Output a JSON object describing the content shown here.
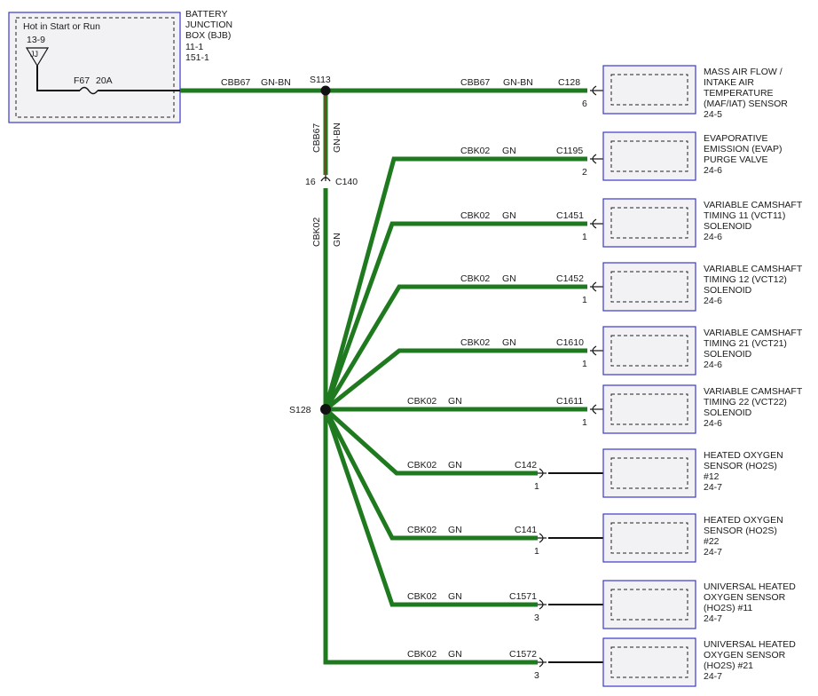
{
  "bjb": {
    "hot_label": "Hot in Start or Run",
    "pin_ref": "13-9",
    "icon_label": "JJ",
    "fuse_label": "F67",
    "fuse_rating": "20A",
    "title_lines": [
      "BATTERY",
      "JUNCTION",
      "BOX (BJB)",
      "11-1",
      "151-1"
    ]
  },
  "splices": {
    "s113": "S113",
    "s128": "S128"
  },
  "main_wire": {
    "left_circuit": "CBB67",
    "left_color": "GN-BN",
    "right_circuit": "CBB67",
    "right_color": "GN-BN",
    "vertical_circuit": "CBB67",
    "vertical_color": "GN-BN"
  },
  "c140": {
    "connector": "C140",
    "pin": "16",
    "lower_circuit": "CBK02",
    "lower_color": "GN"
  },
  "branches": [
    {
      "circuit": "CBB67",
      "color": "GN-BN",
      "connector": "C128",
      "pin": "6",
      "lines": [
        "MASS AIR FLOW /",
        "INTAKE AIR",
        "TEMPERATURE",
        "(MAF/IAT) SENSOR"
      ],
      "page": "24-5"
    },
    {
      "circuit": "CBK02",
      "color": "GN",
      "connector": "C1195",
      "pin": "2",
      "lines": [
        "EVAPORATIVE",
        "EMISSION (EVAP)",
        "PURGE VALVE"
      ],
      "page": "24-6"
    },
    {
      "circuit": "CBK02",
      "color": "GN",
      "connector": "C1451",
      "pin": "1",
      "lines": [
        "VARIABLE CAMSHAFT",
        "TIMING 11 (VCT11)",
        "SOLENOID"
      ],
      "page": "24-6"
    },
    {
      "circuit": "CBK02",
      "color": "GN",
      "connector": "C1452",
      "pin": "1",
      "lines": [
        "VARIABLE CAMSHAFT",
        "TIMING 12 (VCT12)",
        "SOLENOID"
      ],
      "page": "24-6"
    },
    {
      "circuit": "CBK02",
      "color": "GN",
      "connector": "C1610",
      "pin": "1",
      "lines": [
        "VARIABLE CAMSHAFT",
        "TIMING 21 (VCT21)",
        "SOLENOID"
      ],
      "page": "24-6"
    },
    {
      "circuit": "CBK02",
      "color": "GN",
      "connector": "C1611",
      "pin": "1",
      "lines": [
        "VARIABLE CAMSHAFT",
        "TIMING 22 (VCT22)",
        "SOLENOID"
      ],
      "page": "24-6"
    },
    {
      "circuit": "CBK02",
      "color": "GN",
      "connector": "C142",
      "pin": "1",
      "lines": [
        "HEATED OXYGEN",
        "SENSOR (HO2S)",
        "#12"
      ],
      "page": "24-7"
    },
    {
      "circuit": "CBK02",
      "color": "GN",
      "connector": "C141",
      "pin": "1",
      "lines": [
        "HEATED OXYGEN",
        "SENSOR (HO2S)",
        "#22"
      ],
      "page": "24-7"
    },
    {
      "circuit": "CBK02",
      "color": "GN",
      "connector": "C1571",
      "pin": "3",
      "lines": [
        "UNIVERSAL HEATED",
        "OXYGEN SENSOR",
        "(HO2S) #11"
      ],
      "page": "24-7"
    },
    {
      "circuit": "CBK02",
      "color": "GN",
      "connector": "C1572",
      "pin": "3",
      "lines": [
        "UNIVERSAL HEATED",
        "OXYGEN SENSOR",
        "(HO2S) #21"
      ],
      "page": "24-7"
    }
  ]
}
